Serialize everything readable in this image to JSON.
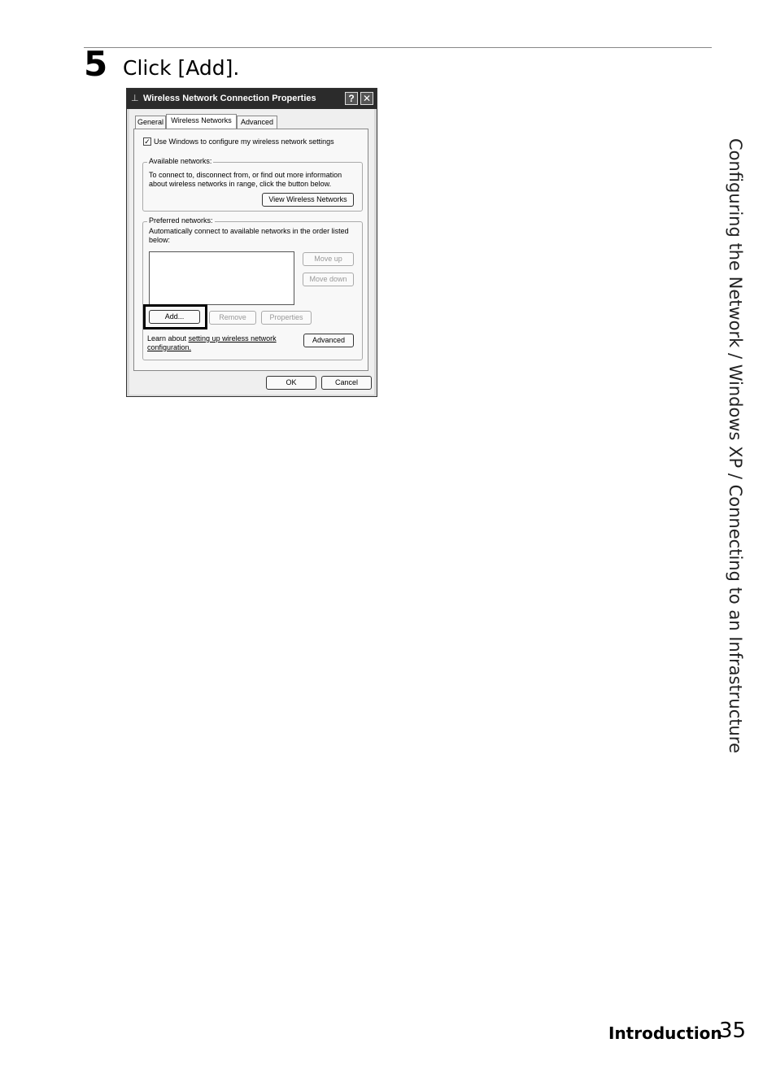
{
  "step": {
    "number": "5",
    "instruction": "Click [Add]."
  },
  "side_title": "Configuring the Network / Windows XP / Connecting to an Infrastructure",
  "footer": {
    "section": "Introduction",
    "page": "35"
  },
  "dialog": {
    "title": "Wireless Network Connection Properties",
    "help_glyph": "?",
    "close_glyph": "✕",
    "tabs": [
      "General",
      "Wireless Networks",
      "Advanced"
    ],
    "use_windows_label": "Use Windows to configure my wireless network settings",
    "available": {
      "legend": "Available networks:",
      "line1": "To connect to, disconnect from, or find out more information",
      "line2": "about wireless networks in range, click the button below.",
      "button": "View Wireless Networks"
    },
    "preferred": {
      "legend": "Preferred networks:",
      "line1": "Automatically connect to available networks in the order listed",
      "line2": "below:",
      "move_up": "Move up",
      "move_down": "Move down",
      "add": "Add...",
      "remove": "Remove",
      "properties": "Properties",
      "learn_prefix": "Learn about ",
      "learn_link_1": "setting up wireless network",
      "learn_link_2": "configuration.",
      "advanced": "Advanced"
    },
    "ok": "OK",
    "cancel": "Cancel"
  }
}
